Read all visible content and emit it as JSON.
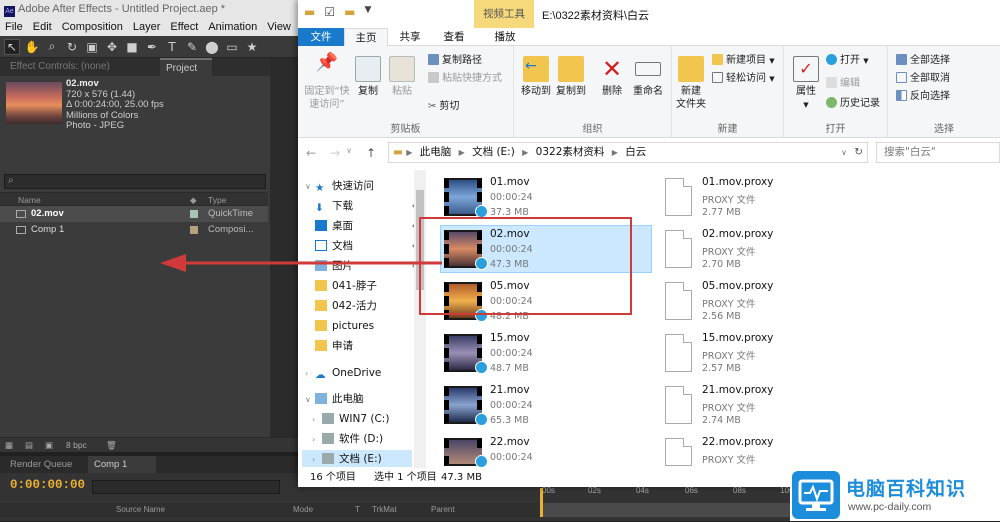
{
  "ae": {
    "title": "Adobe After Effects - Untitled Project.aep *",
    "menu": [
      "File",
      "Edit",
      "Composition",
      "Layer",
      "Effect",
      "Animation",
      "View"
    ],
    "tabs": {
      "effect_controls": "Effect Controls: (none)",
      "project": "Project"
    },
    "footage": {
      "name": "02.mov",
      "size": "720 x 576 (1.44)",
      "duration": "Δ 0:00:24:00, 25.00 fps",
      "colors": "Millions of Colors",
      "codec": "Photo - JPEG"
    },
    "columns": {
      "name": "Name",
      "type": "Type"
    },
    "items": [
      {
        "name": "02.mov",
        "type": "QuickTime",
        "label_color": "#a8c5b5"
      },
      {
        "name": "Comp 1",
        "type": "Composi...",
        "label_color": "#b9a07f"
      }
    ],
    "bpc": "8 bpc",
    "timeline_tabs": {
      "render_queue": "Render Queue",
      "comp": "Comp 1"
    },
    "timecode": "0:00:00:00",
    "timeline_columns": {
      "source": "Source Name",
      "mode": "Mode",
      "t": "T",
      "trkmat": "TrkMat",
      "parent": "Parent"
    },
    "ruler": [
      "00s",
      "02s",
      "04s",
      "06s",
      "08s",
      "10s"
    ]
  },
  "explorer": {
    "context_tab": "视频工具",
    "path_title": "E:\\0322素材资料\\白云",
    "ribbon_tabs": [
      "文件",
      "主页",
      "共享",
      "查看",
      "播放"
    ],
    "groups": {
      "clipboard": {
        "label": "剪贴板",
        "pin": "固定到“快\n速访问”",
        "copy": "复制",
        "paste": "粘贴",
        "copy_path": "复制路径",
        "paste_shortcut": "粘贴快捷方式",
        "cut": "剪切"
      },
      "organize": {
        "label": "组织",
        "move_to": "移动到",
        "copy_to": "复制到",
        "delete": "删除",
        "rename": "重命名"
      },
      "new": {
        "label": "新建",
        "new_folder": "新建\n文件夹",
        "new_item": "新建项目",
        "easy_access": "轻松访问"
      },
      "open": {
        "label": "打开",
        "properties": "属性",
        "open": "打开",
        "edit": "编辑",
        "history": "历史记录"
      },
      "select": {
        "label": "选择",
        "all": "全部选择",
        "none": "全部取消",
        "invert": "反向选择"
      }
    },
    "address": [
      "此电脑",
      "文档 (E:)",
      "0322素材资料",
      "白云"
    ],
    "search_placeholder": "搜索\"白云\"",
    "nav": [
      {
        "label": "快速访问",
        "level": 0,
        "icon": "star-icon"
      },
      {
        "label": "下载",
        "level": 1,
        "icon": "download-icon",
        "pin": true
      },
      {
        "label": "桌面",
        "level": 1,
        "icon": "desktop-icon",
        "pin": true
      },
      {
        "label": "文档",
        "level": 1,
        "icon": "document-icon",
        "pin": true
      },
      {
        "label": "图片",
        "level": 1,
        "icon": "pictures-icon",
        "pin": true
      },
      {
        "label": "041-脖子",
        "level": 1,
        "icon": "folder-icon"
      },
      {
        "label": "042-活力",
        "level": 1,
        "icon": "folder-icon"
      },
      {
        "label": "pictures",
        "level": 1,
        "icon": "folder-icon"
      },
      {
        "label": "申请",
        "level": 1,
        "icon": "folder-icon"
      },
      {
        "label": "OneDrive",
        "level": 0,
        "icon": "cloud-icon"
      },
      {
        "label": "此电脑",
        "level": 0,
        "icon": "computer-icon"
      },
      {
        "label": "WIN7 (C:)",
        "level": 1,
        "icon": "drive-icon"
      },
      {
        "label": "软件 (D:)",
        "level": 1,
        "icon": "drive-icon"
      },
      {
        "label": "文档 (E:)",
        "level": 1,
        "icon": "drive-icon"
      }
    ],
    "files": [
      {
        "name": "01.mov",
        "duration": "00:00:24",
        "size": "37.3 MB"
      },
      {
        "name": "02.mov",
        "duration": "00:00:24",
        "size": "47.3 MB"
      },
      {
        "name": "05.mov",
        "duration": "00:00:24",
        "size": "48.2 MB"
      },
      {
        "name": "15.mov",
        "duration": "00:00:24",
        "size": "48.7 MB"
      },
      {
        "name": "21.mov",
        "duration": "00:00:24",
        "size": "65.3 MB"
      },
      {
        "name": "22.mov",
        "duration": "00:00:24",
        "size": "47.3 MB"
      }
    ],
    "proxies": [
      {
        "name": "01.mov.proxy",
        "type": "PROXY 文件",
        "size": "2.77 MB"
      },
      {
        "name": "02.mov.proxy",
        "type": "PROXY 文件",
        "size": "2.70 MB"
      },
      {
        "name": "05.mov.proxy",
        "type": "PROXY 文件",
        "size": "2.56 MB"
      },
      {
        "name": "15.mov.proxy",
        "type": "PROXY 文件",
        "size": "2.57 MB"
      },
      {
        "name": "21.mov.proxy",
        "type": "PROXY 文件",
        "size": "2.74 MB"
      },
      {
        "name": "22.mov.proxy",
        "type": "PROXY 文件",
        "size": ""
      }
    ],
    "status": {
      "count": "16 个项目",
      "selected": "选中 1 个项目",
      "size": "47.3 MB"
    }
  },
  "watermark": {
    "title": "电脑百科知识",
    "url": "www.pc-daily.com"
  },
  "colors": {
    "annotation": "#d03a3a",
    "selection": "#cce8ff",
    "file_tab": "#1979ca",
    "timecode": "#e9b033",
    "brand": "#1c8ddb"
  }
}
